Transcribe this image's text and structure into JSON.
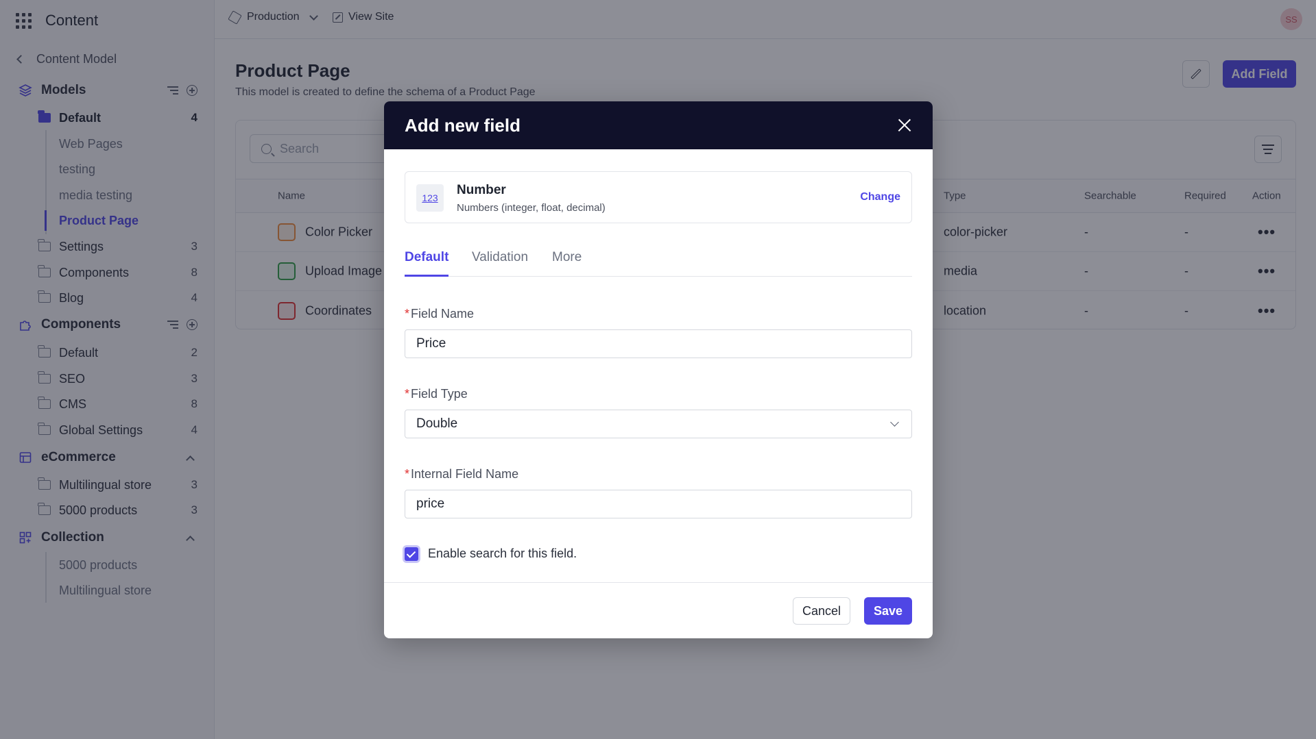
{
  "app": {
    "title": "Content",
    "avatar_initials": "SS"
  },
  "topbar": {
    "environment": "Production",
    "view_site": "View Site"
  },
  "sidebar": {
    "back_label": "Content Model",
    "models": {
      "label": "Models",
      "default_folder": {
        "label": "Default",
        "count": "4"
      },
      "default_items": [
        "Web Pages",
        "testing",
        "media testing",
        "Product Page"
      ],
      "folders": [
        {
          "label": "Settings",
          "count": "3"
        },
        {
          "label": "Components",
          "count": "8"
        },
        {
          "label": "Blog",
          "count": "4"
        }
      ]
    },
    "components": {
      "label": "Components",
      "folders": [
        {
          "label": "Default",
          "count": "2"
        },
        {
          "label": "SEO",
          "count": "3"
        },
        {
          "label": "CMS",
          "count": "8"
        },
        {
          "label": "Global Settings",
          "count": "4"
        }
      ]
    },
    "ecommerce": {
      "label": "eCommerce",
      "folders": [
        {
          "label": "Multilingual store",
          "count": "3"
        },
        {
          "label": "5000 products",
          "count": "3"
        }
      ]
    },
    "collection": {
      "label": "Collection",
      "items": [
        "5000 products",
        "Multilingual store"
      ]
    }
  },
  "main": {
    "title": "Product Page",
    "subtitle": "This model is created to define the schema of a Product Page",
    "add_field_label": "Add Field",
    "search_placeholder": "Search",
    "columns": {
      "name": "Name",
      "type": "Type",
      "searchable": "Searchable",
      "required": "Required",
      "action": "Action"
    },
    "rows": [
      {
        "name": "Color Picker",
        "type": "color-picker",
        "searchable": "-",
        "required": "-",
        "icon": "palette-icon",
        "icon_color": "#f08c3a",
        "icon_bg": "#fdf0e4"
      },
      {
        "name": "Upload Image",
        "type": "media",
        "searchable": "-",
        "required": "-",
        "icon": "image-file-icon",
        "icon_color": "#2f9e44",
        "icon_bg": "#e6f6ea"
      },
      {
        "name": "Coordinates",
        "type": "location",
        "searchable": "-",
        "required": "-",
        "icon": "map-pin-icon",
        "icon_color": "#e03131",
        "icon_bg": "#fde8e8"
      }
    ],
    "row_action": "•••"
  },
  "modal": {
    "title": "Add new field",
    "type_card": {
      "icon_text": "123",
      "name": "Number",
      "description": "Numbers (integer, float, decimal)",
      "change_label": "Change"
    },
    "tabs": [
      "Default",
      "Validation",
      "More"
    ],
    "active_tab": "Default",
    "fields": {
      "field_name": {
        "label": "Field Name",
        "value": "Price"
      },
      "field_type": {
        "label": "Field Type",
        "value": "Double"
      },
      "internal_name": {
        "label": "Internal Field Name",
        "value": "price"
      }
    },
    "required_marker": "*",
    "enable_search": {
      "label": "Enable search for this field.",
      "checked": true
    },
    "cancel_label": "Cancel",
    "save_label": "Save"
  },
  "colors": {
    "accent": "#4f46e5",
    "modal_header": "#10112a",
    "required": "#e03131"
  }
}
